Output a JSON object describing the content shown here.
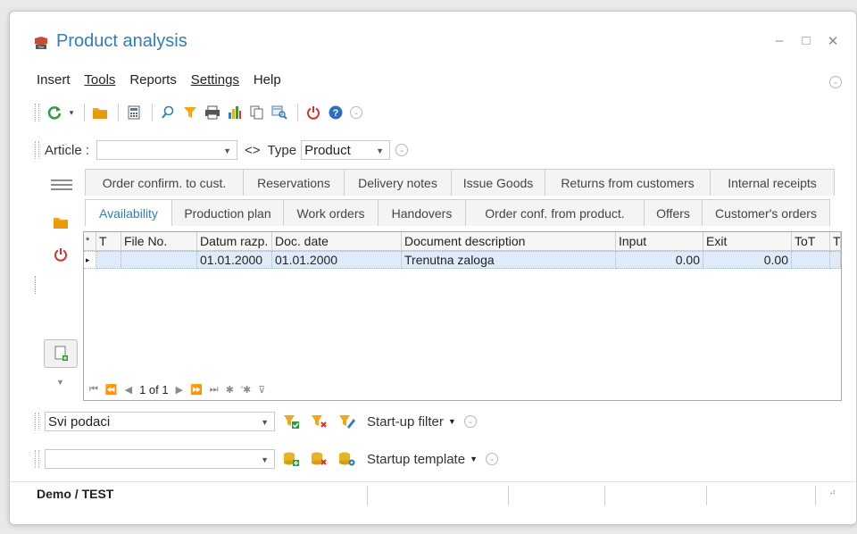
{
  "window": {
    "title": "Product analysis"
  },
  "menu": [
    "Insert",
    "Tools",
    "Reports",
    "Settings",
    "Help"
  ],
  "article": {
    "label": "Article :",
    "value": "",
    "compare": "<>",
    "type_label": "Type",
    "type_value": "Product"
  },
  "tabs_row1": [
    "Order confirm. to cust.",
    "Reservations",
    "Delivery notes",
    "Issue Goods",
    "Returns from customers",
    "Internal receipts"
  ],
  "tabs_row2": [
    "Availability",
    "Production plan",
    "Work orders",
    "Handovers",
    "Order conf. from product.",
    "Offers",
    "Customer's orders"
  ],
  "active_tab": "Availability",
  "grid": {
    "columns": [
      "*",
      "T",
      "File No.",
      "Datum razp.",
      "Doc. date",
      "Document description",
      "Input",
      "Exit",
      "ToT",
      "T"
    ],
    "rows": [
      {
        "marker": "▸",
        "t": "",
        "file_no": "",
        "datum_razp": "01.01.2000",
        "doc_date": "01.01.2000",
        "description": "Trenutna zaloga",
        "input": "0.00",
        "exit": "0.00",
        "tot": "",
        "t2": ""
      }
    ],
    "pager": "1 of 1"
  },
  "filter": {
    "value": "Svi podaci",
    "startup_label": "Start-up filter"
  },
  "template": {
    "value": "",
    "startup_label": "Startup template"
  },
  "status": {
    "company": "Demo / TEST"
  },
  "colors": {
    "accent": "#2f7ec1",
    "selected_row": "#deecf9",
    "refresh": "#2e9d3d",
    "power": "#d9302c"
  }
}
